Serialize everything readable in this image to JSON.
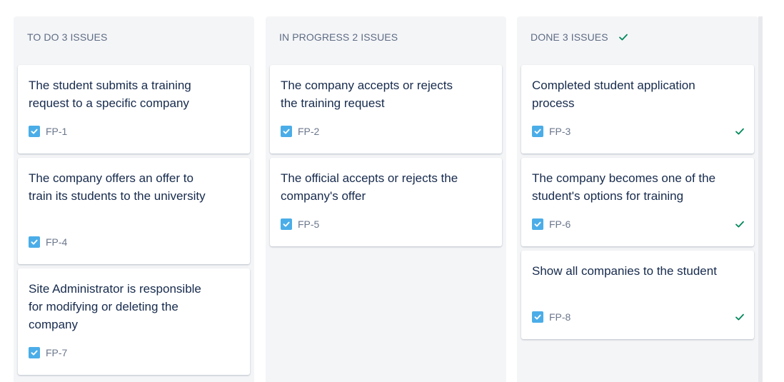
{
  "columns": {
    "todo": {
      "header": "TO DO 3 ISSUES",
      "cards": [
        {
          "title": "The student submits a training request to a specific company",
          "key": "FP-1"
        },
        {
          "title": "The company offers an offer to train its students to the university",
          "key": "FP-4"
        },
        {
          "title": "Site Administrator is responsible for modifying or deleting the company",
          "key": "FP-7"
        }
      ]
    },
    "in_progress": {
      "header": "IN PROGRESS 2 ISSUES",
      "cards": [
        {
          "title": "The company accepts or rejects the training request",
          "key": "FP-2"
        },
        {
          "title": "The official accepts or rejects the company's offer",
          "key": "FP-5"
        }
      ]
    },
    "done": {
      "header": "DONE 3 ISSUES",
      "cards": [
        {
          "title": "Completed student application process",
          "key": "FP-3"
        },
        {
          "title": "The company becomes one of the student's options for training",
          "key": "FP-6"
        },
        {
          "title": "Show all companies to the student",
          "key": "FP-8"
        }
      ]
    }
  },
  "icons": {
    "issue_type": "task-checkbox-icon",
    "done_marker": "check-icon",
    "column_done_marker": "check-icon"
  },
  "colors": {
    "task_icon": "#4bade8",
    "check_green": "#00875a",
    "column_bg": "#f4f5f7",
    "card_text": "#172b4d",
    "muted_text": "#5e6c84"
  }
}
